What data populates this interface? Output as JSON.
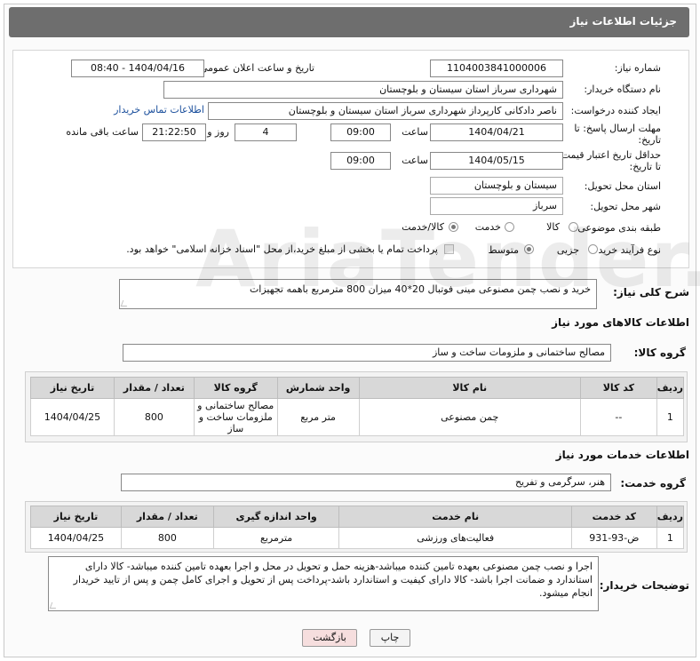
{
  "window": {
    "title": "جزئیات اطلاعات نیاز"
  },
  "form": {
    "need_number_label": "شماره نیاز:",
    "need_number": "1104003841000006",
    "announce_label": "تاریخ و ساعت اعلان عمومی:",
    "announce_value": "1404/04/16 - 08:40",
    "buyer_org_label": "نام دستگاه خریدار:",
    "buyer_org": "شهرداری سرباز استان سیستان و بلوچستان",
    "creator_label": "ایجاد کننده درخواست:",
    "creator": "ناصر دادکانی کارپرداز شهرداری سرباز استان سیستان و بلوچستان",
    "contact_link": "اطلاعات تماس خریدار",
    "deadline_label_1": "مهلت ارسال پاسخ: تا",
    "deadline_label_2": "تاریخ:",
    "deadline_date": "1404/04/21",
    "time_label": "ساعت",
    "deadline_time": "09:00",
    "days_value": "4",
    "days_label": "روز و",
    "remaining_time": "21:22:50",
    "remaining_label": "ساعت باقی مانده",
    "min_price_label_1": "حداقل تاریخ اعتبار قیمت:",
    "min_price_label_2": "تا تاریخ:",
    "min_price_date": "1404/05/15",
    "min_price_time": "09:00",
    "province_label": "استان محل تحویل:",
    "province": "سیستان و بلوچستان",
    "city_label": "شهر محل تحویل:",
    "city": "سرباز",
    "category_label": "طبقه بندی موضوعی:",
    "category_options": [
      "کالا",
      "خدمت",
      "کالا/خدمت"
    ],
    "category_selected": "کالا/خدمت",
    "process_label": "نوع فرآیند خرید :",
    "process_options": [
      "جزیی",
      "متوسط"
    ],
    "process_selected": "متوسط",
    "payment_note": "پرداخت تمام یا بخشی از مبلغ خرید،از محل \"اسناد خزانه اسلامی\" خواهد بود."
  },
  "summary": {
    "label": "شرح کلی نیاز:",
    "text": "خرید و نصب چمن مصنوعی مینی فوتبال 20*40 میزان 800 مترمربع باهمه تجهیزات"
  },
  "goods": {
    "section_title": "اطلاعات کالاهای مورد نیاز",
    "group_label": "گروه کالا:",
    "group_value": "مصالح ساختمانی و ملزومات ساخت و ساز",
    "columns": [
      "ردیف",
      "کد کالا",
      "نام کالا",
      "واحد شمارش",
      "گروه کالا",
      "تعداد / مقدار",
      "تاریخ نیاز"
    ],
    "rows": [
      {
        "index": "1",
        "code": "--",
        "name": "چمن مصنوعی",
        "unit": "متر مربع",
        "group": "مصالح ساختمانی و ملزومات ساخت و ساز",
        "qty": "800",
        "date": "1404/04/25"
      }
    ]
  },
  "services": {
    "section_title": "اطلاعات خدمات مورد نیاز",
    "group_label": "گروه خدمت:",
    "group_value": "هنر، سرگرمی و تفریح",
    "columns": [
      "ردیف",
      "کد خدمت",
      "نام خدمت",
      "واحد اندازه گیری",
      "تعداد / مقدار",
      "تاریخ نیاز"
    ],
    "rows": [
      {
        "index": "1",
        "code": "ض-93-931",
        "name": "فعالیت‌های ورزشی",
        "unit": "مترمربع",
        "qty": "800",
        "date": "1404/04/25"
      }
    ]
  },
  "buyer_notes": {
    "label": "توضیحات خریدار:",
    "text": "اجرا و نصب چمن مصنوعی بعهده تامین کننده میباشد-هزینه حمل و تحویل در محل  و اجرا بعهده تامین کننده میباشد- کالا دارای استاندارد و ضمانت اجرا باشد- کالا دارای کیفیت و استاندارد باشد-پرداخت پس از تحویل و اجرای کامل چمن و پس از تایید خریدار انجام میشود."
  },
  "buttons": {
    "print": "چاپ",
    "back": "بازگشت"
  },
  "watermark": "AriaTender.net",
  "colors": {
    "titlebar": "#6e6e6e",
    "link": "#1b4f9c",
    "back_button": "#f6dede"
  }
}
